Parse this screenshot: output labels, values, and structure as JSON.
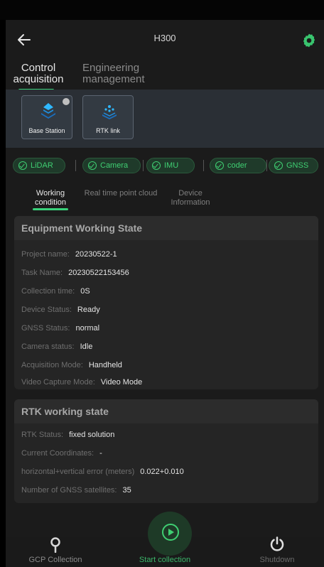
{
  "header": {
    "title": "H300"
  },
  "main_tabs": [
    {
      "label": "Control acquisition"
    },
    {
      "label": "Engineering management"
    }
  ],
  "devices": [
    {
      "label": "Base Station"
    },
    {
      "label": "RTK link"
    }
  ],
  "sensors": [
    {
      "label": "LiDAR"
    },
    {
      "label": "Camera"
    },
    {
      "label": "IMU"
    },
    {
      "label": "coder"
    },
    {
      "label": "GNSS"
    }
  ],
  "sub_tabs": [
    {
      "label": "Working condition"
    },
    {
      "label": "Real time point cloud"
    },
    {
      "label": "Device Information"
    }
  ],
  "equipment": {
    "title": "Equipment Working State",
    "rows": [
      {
        "key": "Project name:",
        "value": "20230522-1"
      },
      {
        "key": "Task Name:",
        "value": "20230522153456"
      },
      {
        "key": "Collection time:",
        "value": "0S"
      },
      {
        "key": "Device Status:",
        "value": "Ready"
      },
      {
        "key": "GNSS Status:",
        "value": "normal"
      },
      {
        "key": "Camera status:",
        "value": "Idle"
      },
      {
        "key": "Acquisition Mode:",
        "value": "Handheld"
      },
      {
        "key": "Video Capture Mode:",
        "value": "Video Mode"
      }
    ]
  },
  "rtk": {
    "title": "RTK working state",
    "rows": [
      {
        "key": "RTK Status:",
        "value": "fixed solution"
      },
      {
        "key": "Current Coordinates:",
        "value": "-"
      },
      {
        "key": "horizontal+vertical error (meters)",
        "value": "0.022+0.010"
      },
      {
        "key": "Number of GNSS satellites:",
        "value": "35"
      }
    ]
  },
  "bottom": {
    "gcp_label": "GCP Collection",
    "start_label": "Start collection",
    "shutdown_label": "Shutdown"
  },
  "colors": {
    "accent": "#39d27a",
    "background": "#1b1b1b",
    "card": "#252525"
  }
}
